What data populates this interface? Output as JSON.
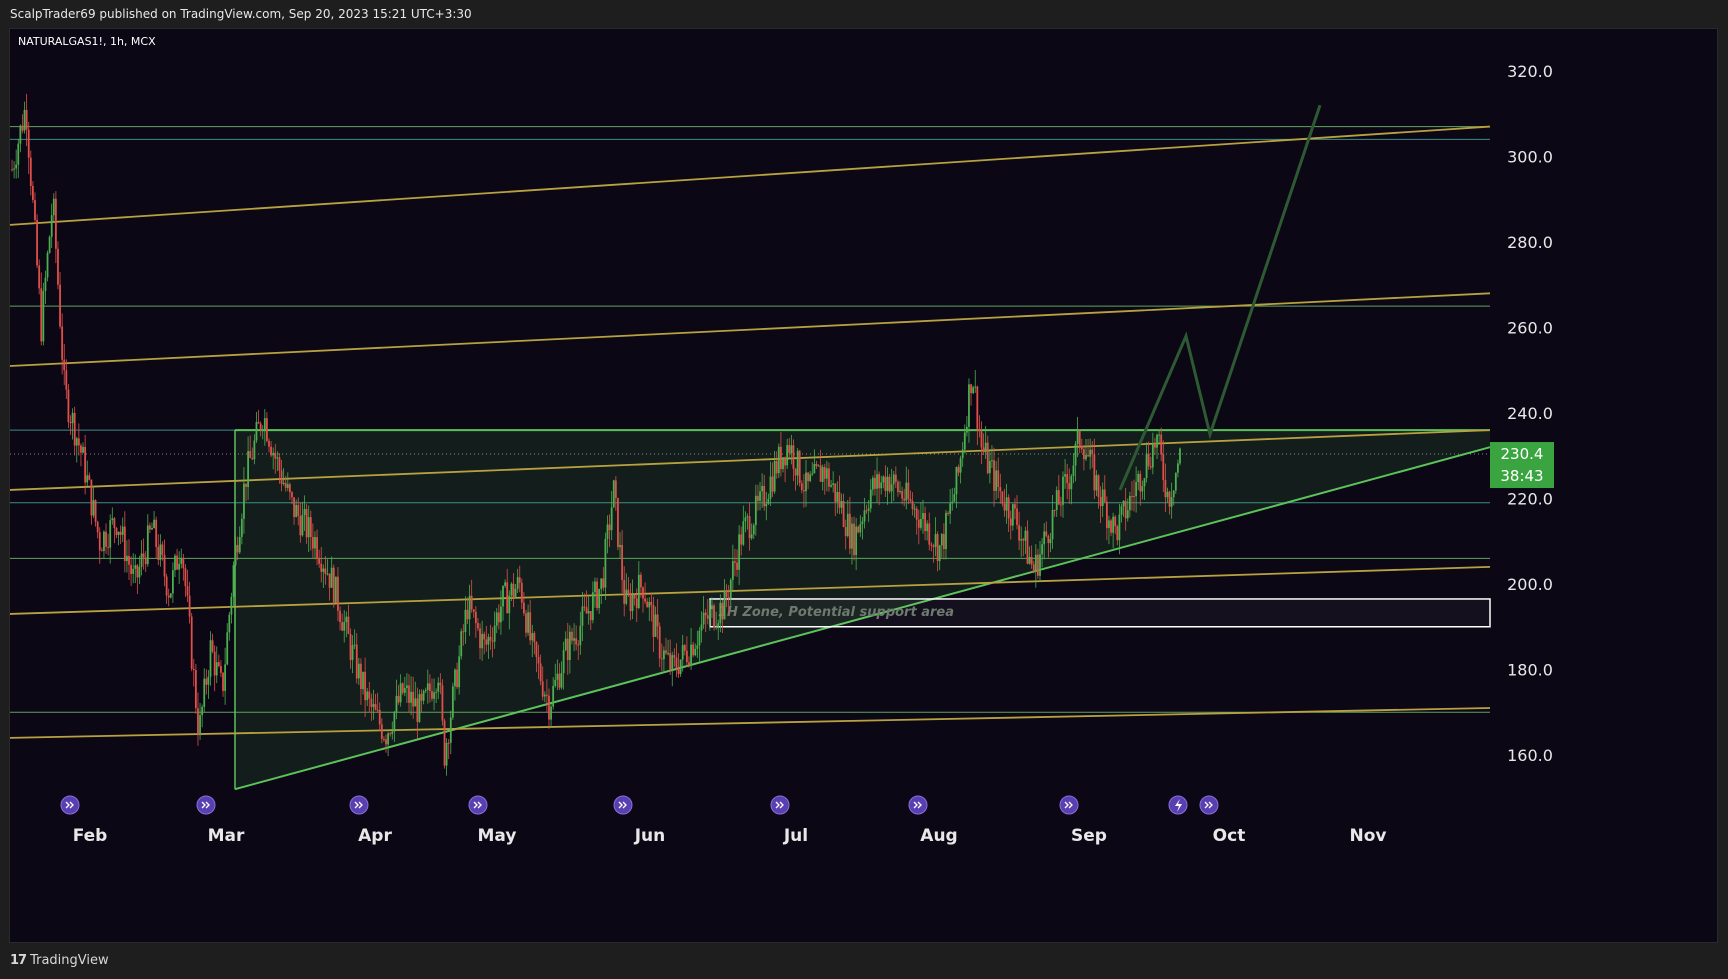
{
  "header": {
    "published_text": "ScalpTrader69 published on TradingView.com, Sep 20, 2023 15:21 UTC+3:30"
  },
  "symbol": {
    "label": "NATURALGAS1!, 1h, MCX"
  },
  "footer": {
    "brand": "TradingView",
    "brand_mark": "17"
  },
  "zone_label": "1H Zone, Potential support area",
  "price_badge": {
    "price": "230.4",
    "countdown": "38:43"
  },
  "colors": {
    "background": "#0b0715",
    "candle_up": "#4caf50",
    "candle_down": "#e0504a",
    "trend_gold": "#b8a240",
    "trend_green": "#5bc35a",
    "horizontal_teal": "#48a59a",
    "projection": "#2e5a33",
    "badge": "#3aa540"
  },
  "icons": {
    "event": "circle-arrows-icon",
    "flash": "lightning-icon"
  },
  "chart_data": {
    "type": "candlestick",
    "symbol": "NATURALGAS1!",
    "interval": "1h",
    "exchange": "MCX",
    "ylim": [
      145,
      330
    ],
    "yticks": [
      "160.0",
      "180.0",
      "200.0",
      "220.0",
      "240.0",
      "260.0",
      "280.0",
      "300.0",
      "320.0"
    ],
    "xticks": [
      "Feb",
      "Mar",
      "Apr",
      "May",
      "Jun",
      "Jul",
      "Aug",
      "Sep",
      "Oct",
      "Nov"
    ],
    "last_price": 230.4,
    "price_path": [
      [
        0,
        297
      ],
      [
        0.012,
        312
      ],
      [
        0.025,
        260
      ],
      [
        0.035,
        290
      ],
      [
        0.045,
        245
      ],
      [
        0.06,
        230
      ],
      [
        0.075,
        210
      ],
      [
        0.09,
        215
      ],
      [
        0.105,
        200
      ],
      [
        0.12,
        213
      ],
      [
        0.135,
        198
      ],
      [
        0.145,
        210
      ],
      [
        0.16,
        165
      ],
      [
        0.17,
        185
      ],
      [
        0.18,
        175
      ],
      [
        0.19,
        205
      ],
      [
        0.2,
        225
      ],
      [
        0.215,
        240
      ],
      [
        0.225,
        230
      ],
      [
        0.24,
        218
      ],
      [
        0.26,
        210
      ],
      [
        0.275,
        200
      ],
      [
        0.29,
        185
      ],
      [
        0.305,
        172
      ],
      [
        0.32,
        165
      ],
      [
        0.335,
        175
      ],
      [
        0.35,
        170
      ],
      [
        0.365,
        180
      ],
      [
        0.37,
        160
      ],
      [
        0.39,
        195
      ],
      [
        0.405,
        185
      ],
      [
        0.42,
        196
      ],
      [
        0.435,
        200
      ],
      [
        0.445,
        185
      ],
      [
        0.46,
        172
      ],
      [
        0.475,
        185
      ],
      [
        0.49,
        192
      ],
      [
        0.505,
        200
      ],
      [
        0.515,
        222
      ],
      [
        0.525,
        195
      ],
      [
        0.54,
        200
      ],
      [
        0.555,
        185
      ],
      [
        0.565,
        180
      ],
      [
        0.58,
        185
      ],
      [
        0.595,
        192
      ],
      [
        0.61,
        195
      ],
      [
        0.625,
        212
      ],
      [
        0.64,
        218
      ],
      [
        0.655,
        228
      ],
      [
        0.665,
        233
      ],
      [
        0.68,
        222
      ],
      [
        0.695,
        227
      ],
      [
        0.71,
        218
      ],
      [
        0.72,
        210
      ],
      [
        0.735,
        222
      ],
      [
        0.75,
        225
      ],
      [
        0.765,
        220
      ],
      [
        0.78,
        215
      ],
      [
        0.795,
        208
      ],
      [
        0.81,
        225
      ],
      [
        0.822,
        250
      ],
      [
        0.83,
        232
      ],
      [
        0.845,
        222
      ],
      [
        0.86,
        215
      ],
      [
        0.875,
        203
      ],
      [
        0.89,
        215
      ],
      [
        0.905,
        225
      ],
      [
        0.915,
        235
      ],
      [
        0.93,
        222
      ],
      [
        0.945,
        212
      ],
      [
        0.955,
        218
      ],
      [
        0.97,
        228
      ],
      [
        0.98,
        234
      ],
      [
        0.99,
        220
      ],
      [
        1,
        230
      ]
    ],
    "trend_lines": [
      {
        "x1": 0,
        "y1": 284,
        "x2": 1,
        "y2": 307
      },
      {
        "x1": 0,
        "y1": 251,
        "x2": 1,
        "y2": 268
      },
      {
        "x1": 0,
        "y1": 222,
        "x2": 1,
        "y2": 236
      },
      {
        "x1": 0,
        "y1": 193,
        "x2": 1,
        "y2": 204
      },
      {
        "x1": 0,
        "y1": 164,
        "x2": 1,
        "y2": 171
      }
    ],
    "horizontal_levels": [
      307,
      304,
      265,
      236,
      219,
      206,
      170
    ],
    "support_zone": [
      190,
      196.5
    ],
    "triangle": {
      "apex_left_top": 236,
      "apex_left_bottom": 152,
      "right_top": 236,
      "right_bottom": 232
    },
    "projection_path": [
      [
        0,
        222
      ],
      [
        0.33,
        258
      ],
      [
        0.45,
        235
      ],
      [
        1,
        312
      ]
    ]
  }
}
